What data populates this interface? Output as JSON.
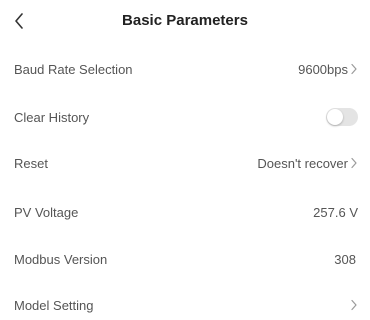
{
  "header": {
    "title": "Basic Parameters",
    "back_icon": "chevron-left-icon"
  },
  "rows": [
    {
      "label": "Baud Rate Selection",
      "value": "9600bps",
      "has_chevron": true
    },
    {
      "label": "Clear History",
      "toggle_on": false
    },
    {
      "label": "Reset",
      "value": "Doesn't recover",
      "has_chevron": true
    },
    {
      "label": "PV Voltage",
      "value": "257.6 V"
    },
    {
      "label": "Modbus Version",
      "value": "308"
    },
    {
      "label": "Model Setting",
      "value": "",
      "has_chevron": true
    }
  ],
  "colors": {
    "text": "#555555",
    "title": "#222222",
    "toggle_off": "#e4e4e4",
    "chevron": "#9a9a9a"
  }
}
